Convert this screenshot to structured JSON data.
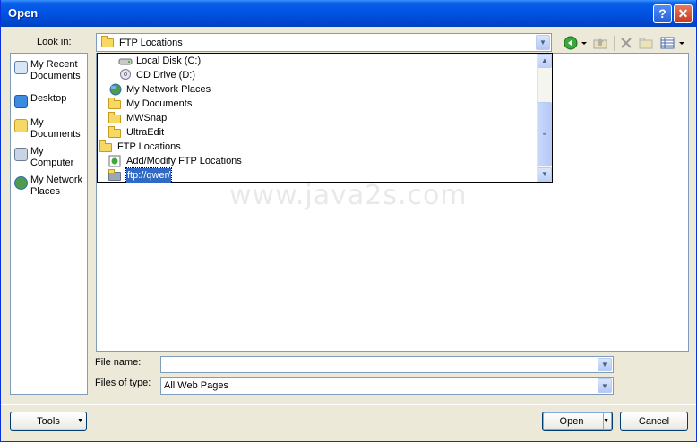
{
  "window": {
    "title": "Open",
    "help_glyph": "?",
    "close_glyph": "✕"
  },
  "toolbar": {
    "look_in_label": "Look in:",
    "look_in_value": "FTP Locations",
    "icons": [
      "back-icon",
      "up-folder-icon",
      "delete-icon",
      "new-folder-icon",
      "views-icon"
    ]
  },
  "places": [
    {
      "label": "My Recent Documents",
      "icon": "recent-documents-icon"
    },
    {
      "label": "Desktop",
      "icon": "desktop-icon"
    },
    {
      "label": "My Documents",
      "icon": "my-documents-icon"
    },
    {
      "label": "My Computer",
      "icon": "my-computer-icon"
    },
    {
      "label": "My Network Places",
      "icon": "network-places-icon"
    }
  ],
  "dropdown": {
    "items": [
      {
        "label": "Local Disk (C:)",
        "icon": "local-disk-icon"
      },
      {
        "label": "CD Drive (D:)",
        "icon": "cd-drive-icon"
      },
      {
        "label": "My Network Places",
        "icon": "network-places-icon"
      },
      {
        "label": "My Documents",
        "icon": "my-documents-icon"
      },
      {
        "label": "MWSnap",
        "icon": "folder-icon"
      },
      {
        "label": "UltraEdit",
        "icon": "folder-icon"
      },
      {
        "label": "FTP Locations",
        "icon": "folder-icon"
      },
      {
        "label": "Add/Modify FTP Locations",
        "icon": "add-ftp-icon"
      },
      {
        "label": "ftp://qwer/",
        "icon": "ftp-site-icon",
        "selected": true
      }
    ]
  },
  "watermark": "www.java2s.com",
  "form": {
    "file_name_label": "File name:",
    "file_name_value": "",
    "file_type_label": "Files of type:",
    "file_type_value": "All Web Pages"
  },
  "buttons": {
    "tools": "Tools",
    "open": "Open",
    "cancel": "Cancel"
  },
  "colors": {
    "title_bar": "#0054e3",
    "dialog_bg": "#ece9d8",
    "selection": "#316ac5",
    "border": "#7f9db9"
  }
}
